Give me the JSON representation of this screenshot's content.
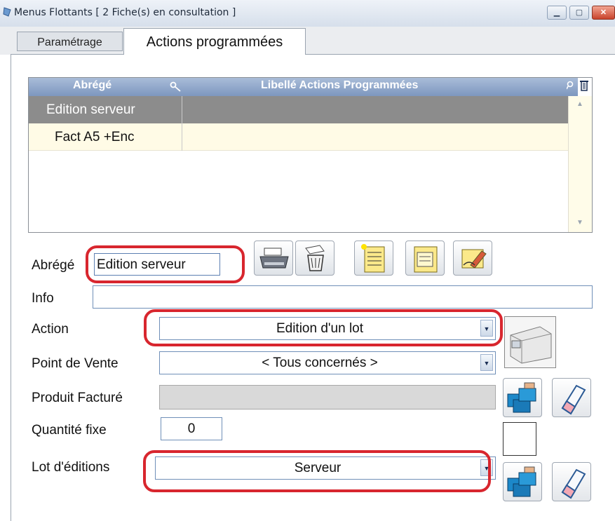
{
  "window": {
    "title": "Menus Flottants  [ 2 Fiche(s) en consultation ]",
    "buttons": {
      "minimize": "▁",
      "maximize": "▢",
      "close": "✕"
    }
  },
  "tabs": [
    {
      "label": "Paramétrage",
      "active": false
    },
    {
      "label": "Actions programmées",
      "active": true
    }
  ],
  "grid": {
    "columns": [
      {
        "label": "Abrégé",
        "icon": "key-icon"
      },
      {
        "label": "Libellé Actions Programmées",
        "icon": "search-icon"
      }
    ],
    "rows": [
      {
        "abrege": "Edition serveur",
        "libelle": "",
        "selected": true
      },
      {
        "abrege": "Fact A5 +Enc",
        "libelle": "",
        "selected": false
      }
    ],
    "scroll": {
      "up": "▲",
      "down": "▼"
    }
  },
  "form": {
    "abrege": {
      "label": "Abrégé",
      "value": "Edition serveur"
    },
    "info": {
      "label": "Info",
      "value": ""
    },
    "action": {
      "label": "Action",
      "value": "Edition d'un lot"
    },
    "point_de_vente": {
      "label": "Point de Vente",
      "value": "< Tous concernés >"
    },
    "produit_facture": {
      "label": "Produit Facturé",
      "value": ""
    },
    "quantite_fixe": {
      "label": "Quantité fixe",
      "value": "0"
    },
    "lot_editions": {
      "label": "Lot d'éditions",
      "value": "Serveur"
    },
    "combo_arrow": "▼"
  },
  "toolbar": [
    "printer-icon",
    "trash-icon",
    "new-document-icon",
    "folder-document-icon",
    "edit-icon"
  ],
  "highlight_color": "#d8262e"
}
